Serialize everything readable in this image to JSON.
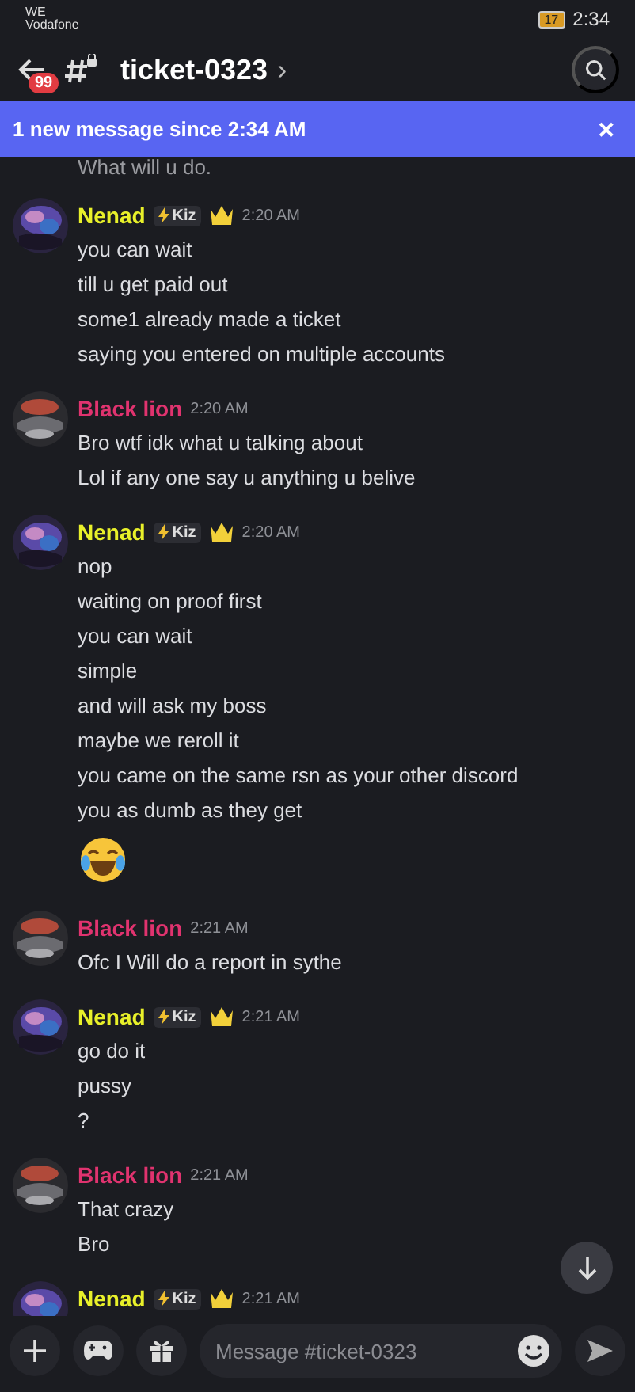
{
  "status_bar": {
    "carrier_top": "WE",
    "carrier": "Vodafone",
    "battery": "17",
    "time": "2:34"
  },
  "header": {
    "unread_count": "99",
    "channel": "ticket-0323",
    "chevron": "›"
  },
  "banner": {
    "text": "1 new message since 2:34 AM",
    "close": "✕"
  },
  "partial_line": "What will u do.",
  "messages": [
    {
      "author": "Nenad",
      "kind": "nenad",
      "color": "#e8f02a",
      "tag": "Kiz",
      "crown": true,
      "time": "2:20 AM",
      "lines": [
        {
          "kind": "text",
          "text": "you can wait"
        },
        {
          "kind": "text",
          "text": "till u get paid out"
        },
        {
          "kind": "text",
          "text": "some1 already made a ticket"
        },
        {
          "kind": "text",
          "text": "saying you entered on multiple accounts"
        }
      ]
    },
    {
      "author": "Black lion",
      "kind": "lion",
      "color": "#e0336f",
      "crown": false,
      "time": "2:20 AM",
      "lines": [
        {
          "kind": "text",
          "text": "Bro wtf idk what u talking about"
        },
        {
          "kind": "text",
          "text": "Lol if any one say u anything u belive"
        }
      ]
    },
    {
      "author": "Nenad",
      "kind": "nenad",
      "color": "#e8f02a",
      "tag": "Kiz",
      "crown": true,
      "time": "2:20 AM",
      "lines": [
        {
          "kind": "text",
          "text": "nop"
        },
        {
          "kind": "text",
          "text": "waiting on proof first"
        },
        {
          "kind": "text",
          "text": "you can wait"
        },
        {
          "kind": "text",
          "text": "simple"
        },
        {
          "kind": "text",
          "text": "and will ask my boss"
        },
        {
          "kind": "text",
          "text": "maybe we reroll it"
        },
        {
          "kind": "text",
          "text": "you came on the same rsn as your other discord"
        },
        {
          "kind": "text",
          "text": "you as dumb as they get"
        },
        {
          "kind": "emoji"
        }
      ]
    },
    {
      "author": "Black lion",
      "kind": "lion",
      "color": "#e0336f",
      "crown": false,
      "time": "2:21 AM",
      "lines": [
        {
          "kind": "text",
          "text": "Ofc I Will do a report in sythe"
        }
      ]
    },
    {
      "author": "Nenad",
      "kind": "nenad",
      "color": "#e8f02a",
      "tag": "Kiz",
      "crown": true,
      "time": "2:21 AM",
      "lines": [
        {
          "kind": "text",
          "text": "go do it"
        },
        {
          "kind": "text",
          "text": "pussy"
        },
        {
          "kind": "text",
          "text": "?"
        }
      ]
    },
    {
      "author": "Black lion",
      "kind": "lion",
      "color": "#e0336f",
      "crown": false,
      "time": "2:21 AM",
      "lines": [
        {
          "kind": "text",
          "text": "That crazy"
        },
        {
          "kind": "text",
          "text": "Bro"
        }
      ]
    },
    {
      "author": "Nenad",
      "kind": "nenad",
      "color": "#e8f02a",
      "tag": "Kiz",
      "crown": true,
      "time": "2:21 AM"
    }
  ],
  "composer": {
    "placeholder": "Message #ticket-0323"
  }
}
